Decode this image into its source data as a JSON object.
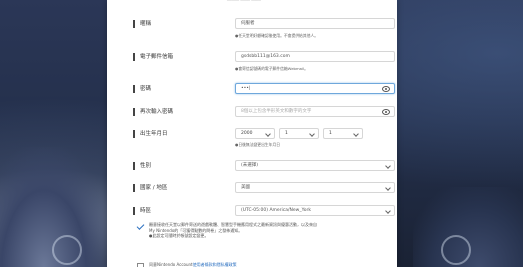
{
  "form": {
    "top_text": "───── ──── ────",
    "nickname": {
      "label": "暱稱",
      "value": "伺服者",
      "hint": "●任天堂明好顧確認後使用。不會提供給其他人。"
    },
    "email": {
      "label": "電子郵件信箱",
      "value": "gsdsbb111@163.com",
      "hint": "●會寄信認號碼的電子郵件信箱Webmail。"
    },
    "password": {
      "label": "密碼",
      "value": "•••|"
    },
    "password_confirm": {
      "label": "再次輸入密碼",
      "placeholder": "8個以上包含半形英文和數字的文字"
    },
    "birthday": {
      "label": "出生年月日",
      "year": "2000",
      "month": "1",
      "day": "1",
      "hint": "●日後無法變更出生年月日"
    },
    "gender": {
      "label": "性別",
      "value": "(未選擇)"
    },
    "region": {
      "label": "國家 / 地區",
      "value": "美國"
    },
    "timezone": {
      "label": "時區",
      "value": "(UTC-05:00) America/New_York"
    },
    "agreement": {
      "text_1": "願意接收任天堂以郵件寄送的遊戲軟體、智慧型手機應用程式之最新資訊與優惠活動，以及來自",
      "text_2": "My Nintendo的「可獲得點數的問卷」之發佈通知。",
      "text_3": "●此設定可隨時於帳號設定變更。"
    },
    "terms": {
      "prefix": "同意Nintendo Account",
      "link": "使用者條款和隱私權政策"
    }
  }
}
